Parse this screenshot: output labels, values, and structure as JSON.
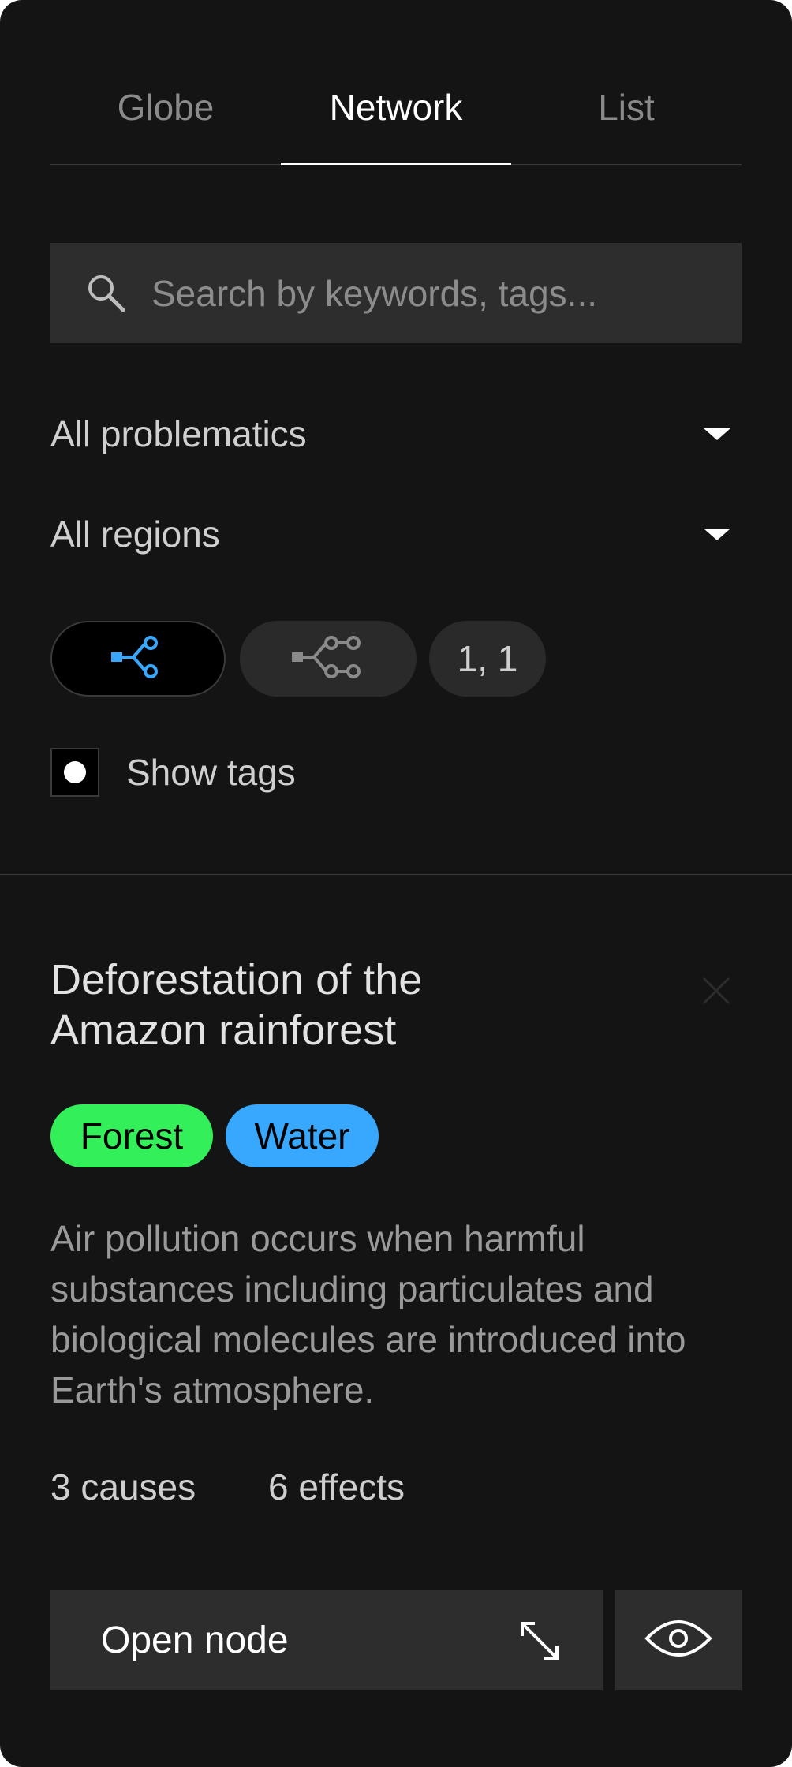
{
  "tabs": [
    {
      "label": "Globe"
    },
    {
      "label": "Network"
    },
    {
      "label": "List"
    }
  ],
  "search": {
    "placeholder": "Search by keywords, tags...",
    "value": ""
  },
  "filters": {
    "problematics": "All problematics",
    "regions": "All regions"
  },
  "view_modes": {
    "level_label": "1, 1"
  },
  "show_tags": {
    "label": "Show tags",
    "checked": true
  },
  "node": {
    "title": "Deforestation of the Amazon rainforest",
    "tags": [
      {
        "label": "Forest",
        "color": "#33ef5a"
      },
      {
        "label": "Water",
        "color": "#38a8ff"
      }
    ],
    "description": "Air pollution occurs when harmful substances including particulates and biological molecules are introduced into Earth's atmosphere.",
    "causes": "3 causes",
    "effects": "6 effects",
    "open_label": "Open node"
  },
  "colors": {
    "background": "#141414",
    "surface": "#2d2d2d",
    "accent_blue": "#38a8ff",
    "text_muted": "#9a9a9a"
  },
  "icons": {
    "search": "search-icon",
    "caret": "caret-down-icon",
    "network_causes": "branch-network-icon",
    "network_effects": "branch-network-outline-icon",
    "close": "close-icon",
    "expand": "expand-arrows-icon",
    "preview": "eye-icon"
  }
}
